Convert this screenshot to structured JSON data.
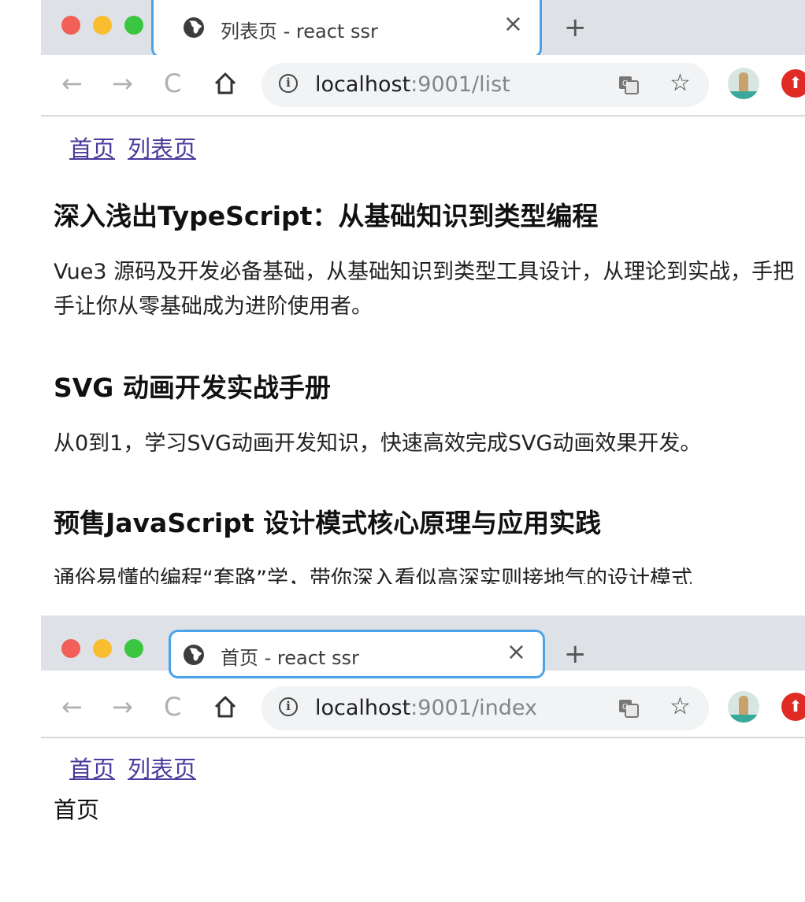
{
  "list_window": {
    "tab_title": "列表页 - react ssr",
    "url_host": "localhost",
    "url_path": ":9001/list",
    "nav": {
      "home_link": "首页",
      "list_link": "列表页"
    },
    "articles": [
      {
        "title": "深入浅出TypeScript：从基础知识到类型编程",
        "desc": "Vue3 源码及开发必备基础，从基础知识到类型工具设计，从理论到实战，手把手让你从零基础成为进阶使用者。"
      },
      {
        "title": "SVG 动画开发实战手册",
        "desc": "从0到1，学习SVG动画开发知识，快速高效完成SVG动画效果开发。"
      },
      {
        "title": "预售JavaScript 设计模式核心原理与应用实践",
        "desc": "通俗易懂的编程“套路”学，带你深入看似高深实则接地气的设计模式"
      }
    ]
  },
  "index_window": {
    "tab_title": "首页 - react ssr",
    "url_host": "localhost",
    "url_path": ":9001/index",
    "nav": {
      "home_link": "首页",
      "list_link": "列表页"
    },
    "page_text": "首页"
  },
  "icons": {
    "close": "×",
    "new_tab": "+",
    "back": "←",
    "forward": "→",
    "reload": "C",
    "home": "⌂",
    "info": "i",
    "star": "☆",
    "ext": "⬆"
  },
  "colors": {
    "tab_strip": "#dee1e6",
    "tab_focus": "#4aa3e8",
    "link": "#4a3a9c",
    "omnibox": "#f1f3f4"
  }
}
